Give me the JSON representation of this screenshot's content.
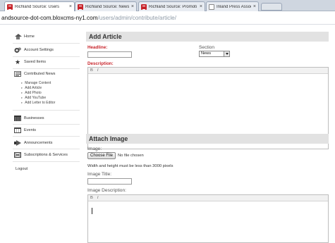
{
  "browser": {
    "tabs": [
      {
        "title": "Richland Source: Users",
        "close": "×",
        "active": true
      },
      {
        "title": "Richland Source: News",
        "close": "×",
        "active": false
      },
      {
        "title": "Richland Source: Promoti",
        "close": "×",
        "active": false
      },
      {
        "title": "Inland Press Association",
        "close": "×",
        "active": false
      }
    ],
    "url_host": "andsource-dot-com.bloxcms-ny1.com",
    "url_path": "/users/admin/contribute/article/"
  },
  "sidebar": {
    "home": "Home",
    "account_settings": "Account Settings",
    "saved_items": "Saved Items",
    "contributed_news": "Contributed News",
    "sub_items": [
      "Manage Content",
      "Add Article",
      "Add Photo",
      "Add YouTube",
      "Add Letter to Editor"
    ],
    "businesses": "Businesses",
    "events": "Events",
    "announcements": "Announcements",
    "subscriptions": "Subscriptions & Services",
    "logout": "Logout"
  },
  "add_article": {
    "heading": "Add Article",
    "headline_label": "Headline:",
    "headline_value": "",
    "section_label": "Section",
    "section_value": "News",
    "description_label": "Description:",
    "toolbar_bold": "B",
    "toolbar_italic": "I"
  },
  "attach_image": {
    "heading": "Attach Image",
    "image_label": "Image:",
    "choose_file": "Choose File",
    "no_file": "No file chosen",
    "size_note": "Width and height must be less than 3000 pixels",
    "title_label": "Image Title:",
    "title_value": "",
    "description_label": "Image Description:",
    "toolbar_bold": "B",
    "toolbar_italic": "I"
  }
}
